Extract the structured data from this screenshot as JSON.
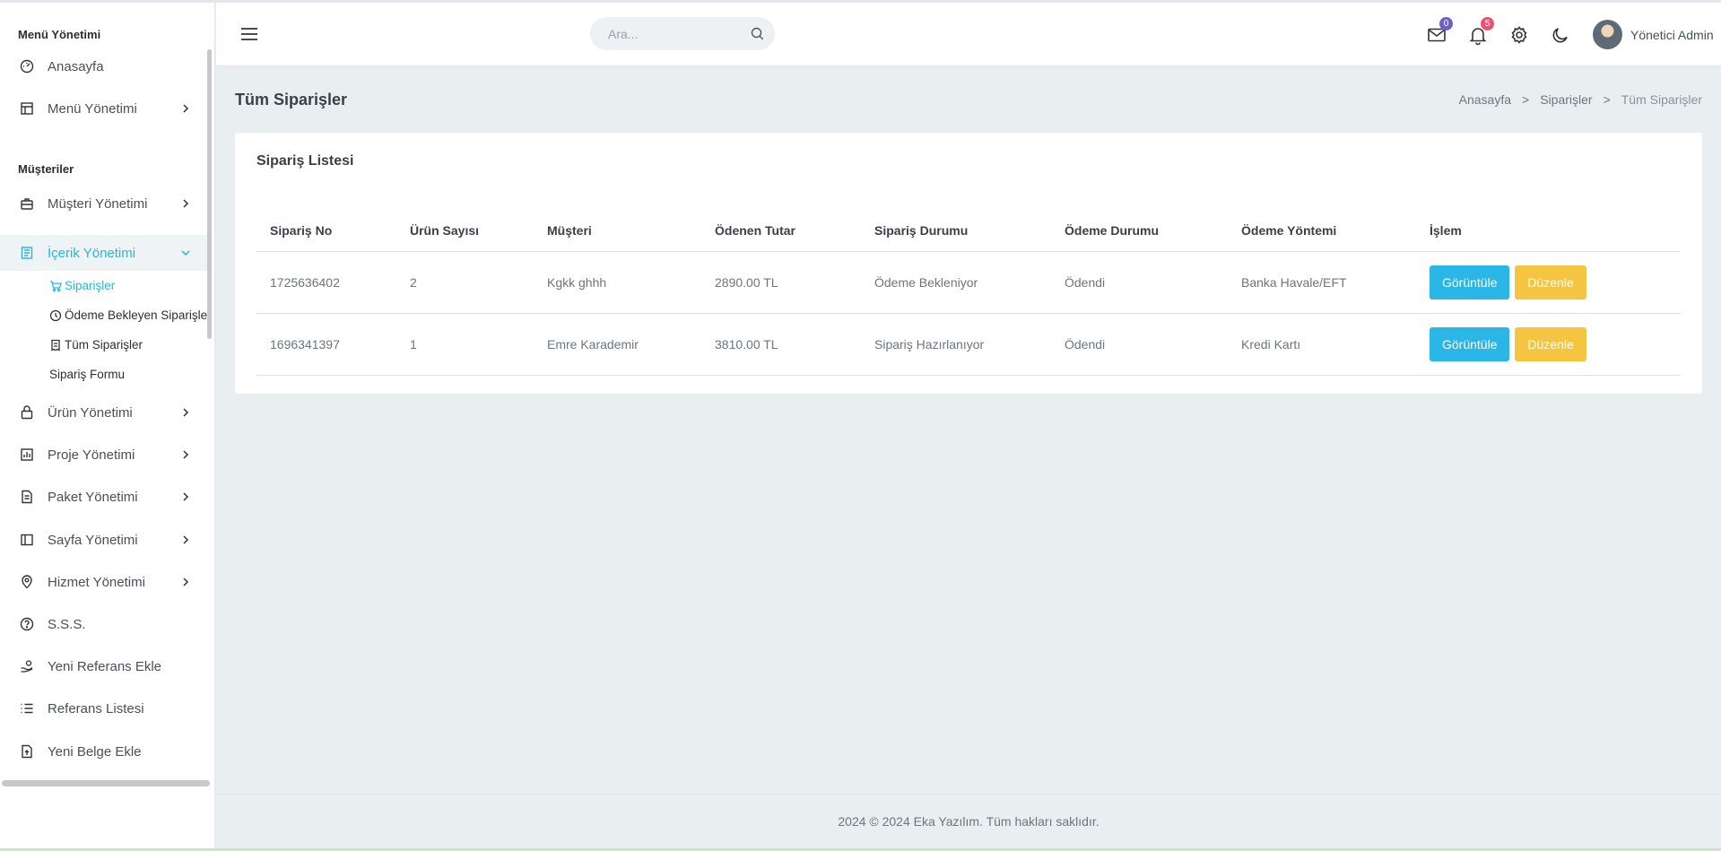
{
  "sidebar": {
    "heading_menu": "Menü Yönetimi",
    "heading_customers": "Müşteriler",
    "items": [
      {
        "label": "Anasayfa"
      },
      {
        "label": "Menü Yönetimi"
      },
      {
        "label": "Müşteri Yönetimi"
      },
      {
        "label": "İçerik Yönetimi"
      },
      {
        "label": "Ürün Yönetimi"
      },
      {
        "label": "Proje Yönetimi"
      },
      {
        "label": "Paket Yönetimi"
      },
      {
        "label": "Sayfa Yönetimi"
      },
      {
        "label": "Hizmet Yönetimi"
      },
      {
        "label": "S.S.S."
      },
      {
        "label": "Yeni Referans Ekle"
      },
      {
        "label": "Referans Listesi"
      },
      {
        "label": "Yeni Belge Ekle"
      }
    ],
    "subitems": [
      {
        "label": "Siparişler"
      },
      {
        "label": "Ödeme Bekleyen Siparişler"
      },
      {
        "label": "Tüm Siparişler"
      },
      {
        "label": "Sipariş Formu"
      }
    ]
  },
  "topbar": {
    "search_placeholder": "Ara...",
    "mail_badge": "0",
    "notification_badge": "5",
    "user_name": "Yönetici Admin"
  },
  "page": {
    "title": "Tüm Siparişler",
    "breadcrumb": [
      "Anasayfa",
      ">",
      "Siparişler",
      ">",
      "Tüm Siparişler"
    ]
  },
  "card": {
    "title": "Sipariş Listesi",
    "columns": [
      "Sipariş No",
      "Ürün Sayısı",
      "Müşteri",
      "Ödenen Tutar",
      "Sipariş Durumu",
      "Ödeme Durumu",
      "Ödeme Yöntemi",
      "İşlem"
    ],
    "rows": [
      {
        "no": "1725636402",
        "count": "2",
        "customer": "Kgkk ghhh",
        "amount": "2890.00 TL",
        "order_status": "Ödeme Bekleniyor",
        "payment_status": "Ödendi",
        "payment_method": "Banka Havale/EFT"
      },
      {
        "no": "1696341397",
        "count": "1",
        "customer": "Emre Karademir",
        "amount": "3810.00 TL",
        "order_status": "Sipariş Hazırlanıyor",
        "payment_status": "Ödendi",
        "payment_method": "Kredi Kartı"
      }
    ],
    "view_label": "Görüntüle",
    "edit_label": "Düzenle"
  },
  "footer": {
    "text": "2024 © 2024 Eka Yazılım. Tüm hakları saklıdır."
  },
  "colors": {
    "accent": "#2ab6d6",
    "info": "#2ab6e6",
    "warning": "#f5c542",
    "mail_badge": "#6f5fc7",
    "notification_badge": "#f0506e"
  }
}
